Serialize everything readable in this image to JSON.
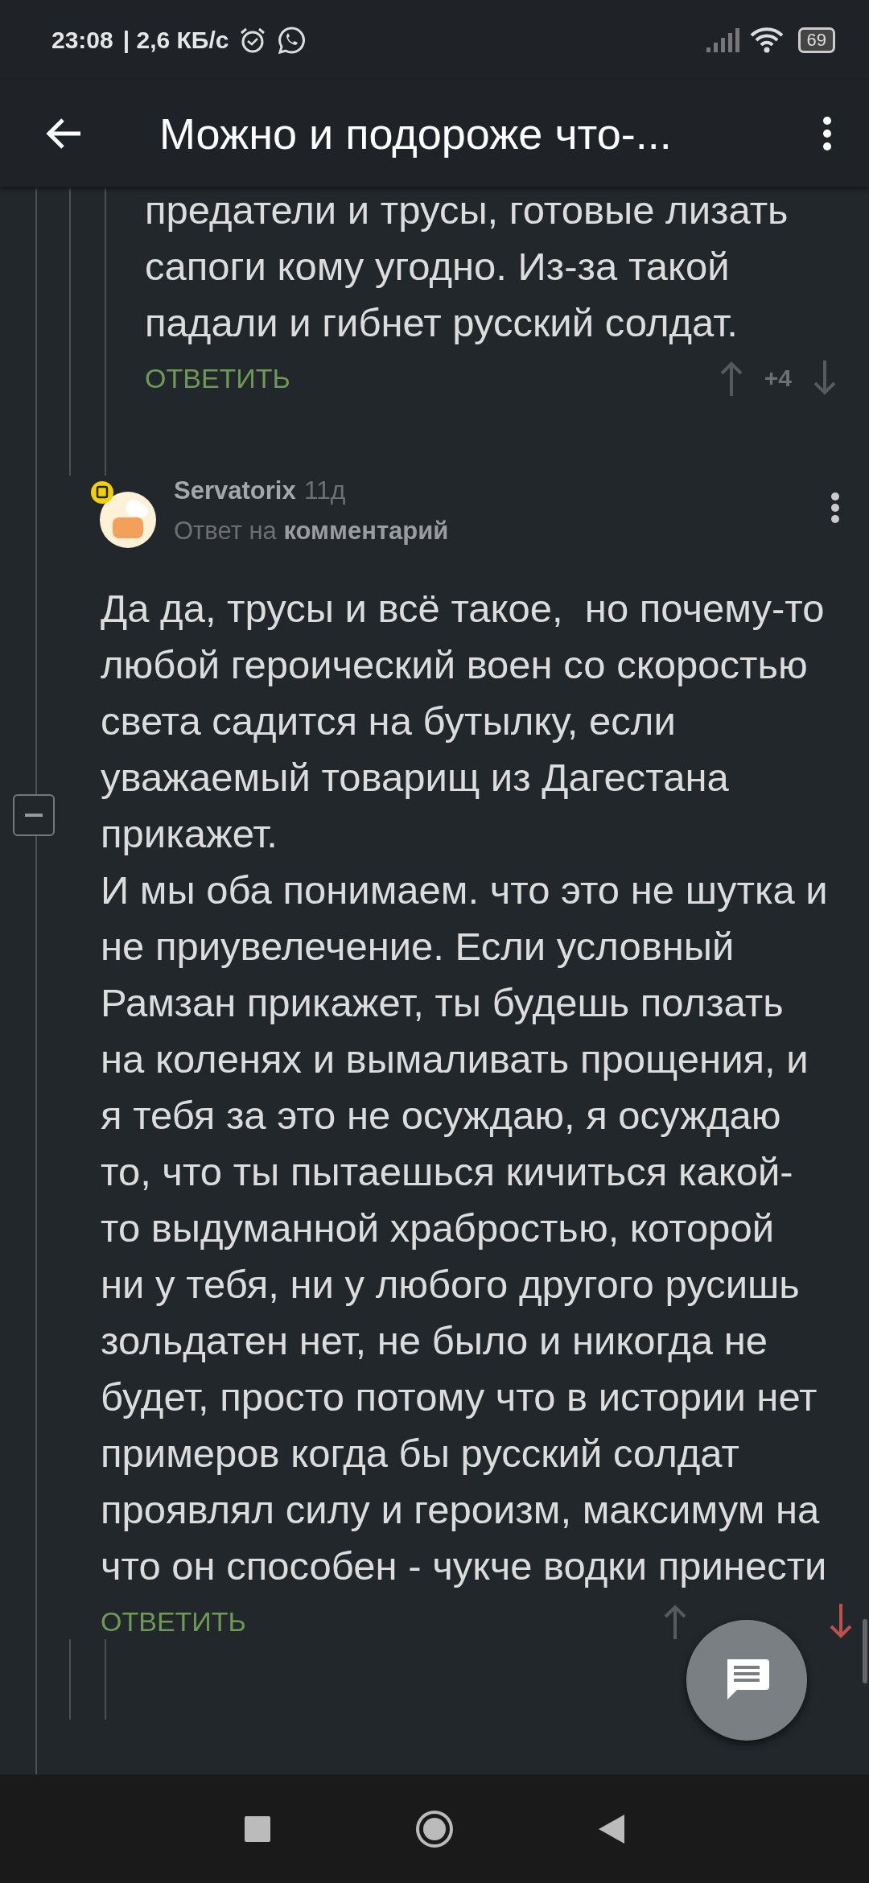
{
  "status_bar": {
    "time": "23:08",
    "speed": "| 2,6 КБ/с",
    "battery": "69"
  },
  "toolbar": {
    "title": "Можно и подороже что-..."
  },
  "comments": [
    {
      "kind": "fragment",
      "paragraphs": [
        "предатели и трусы, готовые лизать сапоги кому угодно. Из-за такой падали и гибнет русский солдат."
      ],
      "reply": "ОТВЕТИТЬ",
      "score": "+4"
    },
    {
      "kind": "full",
      "author": "Servatorix",
      "age": "11д",
      "reply_to": "Ответ на **комментарий**",
      "paragraphs": [
        "Да да, трусы и всё такое,  но почему-то любой героический воен со скоростью света садится на бутылку, если уважаемый товарищ из Дагестана прикажет.",
        "И мы оба понимаем. что это не шутка и не приувелечение. Если условный Рамзан прикажет, ты будешь ползать на коленях и вымаливать прощения, и я тебя за это не осуждаю, я осуждаю то, что ты пытаешься кичиться какой-то выдуманной храбростью, которой ни у тебя, ни у любого другого русишь зольдатен нет, не было и никогда не будет, просто потому что в истории нет примеров когда бы русский солдат проявлял силу и героизм, максимум на что он способен - чукче водки принести"
      ],
      "reply": "ОТВЕТИТЬ"
    }
  ]
}
